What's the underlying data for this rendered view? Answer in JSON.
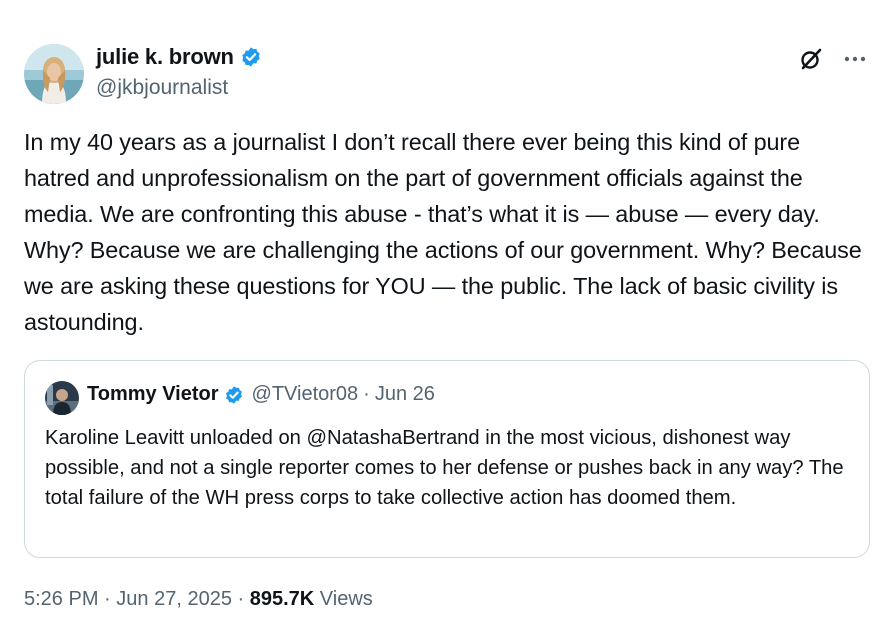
{
  "author": {
    "display_name": "julie k. brown",
    "handle": "@jkbjournalist"
  },
  "icons": {
    "verified": "verified-badge-icon",
    "grok": "grok-icon",
    "more": "more-icon"
  },
  "tweet": {
    "text": "In my 40 years as a journalist I don’t recall there ever being this kind of pure hatred and unprofessionalism on the part of government officials against the media. We are confronting this abuse - that’s what it is — abuse — every day. Why? Because we are challenging the actions of our government. Why?  Because we are asking these questions for YOU — the public. The lack of basic civility is astounding."
  },
  "quoted": {
    "display_name": "Tommy Vietor",
    "handle": "@TVietor08",
    "separator": "·",
    "date": "Jun 26",
    "text": "Karoline Leavitt unloaded on @NatashaBertrand in the most vicious, dishonest way possible, and not a single reporter comes to her defense or pushes back in any way? The total failure of the WH press corps to take collective action has doomed them."
  },
  "meta": {
    "time": "5:26 PM",
    "separator": "·",
    "date": "Jun 27, 2025",
    "views_count": "895.7K",
    "views_label": "Views"
  },
  "colors": {
    "verified_blue": "#1d9bf0",
    "text_primary": "#0f1419",
    "text_secondary": "#536471",
    "border": "#cfd9de"
  }
}
